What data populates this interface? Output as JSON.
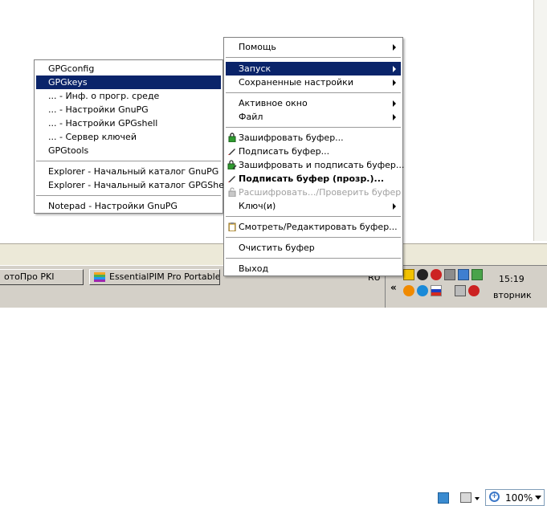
{
  "statusbar": {
    "zoom_value": "100%"
  },
  "taskbar": {
    "buttons": [
      {
        "label": "отоПро PKI"
      },
      {
        "label": "EssentialPIM Pro Portable"
      }
    ],
    "language": "RU",
    "clock": "15:19",
    "day": "вторник"
  },
  "left_menu": {
    "items": [
      {
        "label": "GPGconfig"
      },
      {
        "label": "GPGkeys"
      },
      {
        "label": "... - Инф. о прогр. среде"
      },
      {
        "label": "... - Настройки GnuPG"
      },
      {
        "label": "... - Настройки GPGshell"
      },
      {
        "label": "... - Сервер ключей"
      },
      {
        "label": "GPGtools"
      },
      {
        "label": "Explorer - Начальный каталог GnuPG"
      },
      {
        "label": "Explorer - Начальный каталог GPGShell"
      },
      {
        "label": "Notepad - Настройки GnuPG"
      }
    ]
  },
  "right_menu": {
    "items": [
      {
        "label": "Помощь"
      },
      {
        "label": "Запуск"
      },
      {
        "label": "Сохраненные настройки"
      },
      {
        "label": "Активное окно"
      },
      {
        "label": "Файл"
      },
      {
        "label": "Зашифровать буфер..."
      },
      {
        "label": "Подписать буфер..."
      },
      {
        "label": "Зашифровать и подписать буфер..."
      },
      {
        "label": "Подписать буфер (прозр.)..."
      },
      {
        "label": "Расшифровать.../Проверить буфер"
      },
      {
        "label": "Ключ(и)"
      },
      {
        "label": "Смотреть/Редактировать буфер..."
      },
      {
        "label": "Очистить буфер"
      },
      {
        "label": "Выход"
      }
    ]
  }
}
